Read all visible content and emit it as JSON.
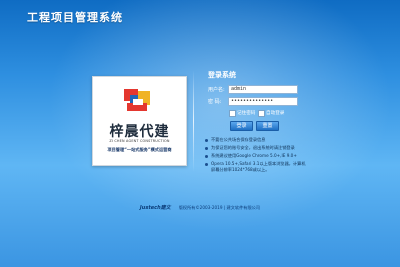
{
  "window": {
    "title": "工程项目管理系统"
  },
  "logo": {
    "cn": "梓晨代建",
    "en": "ZI CHEN AGENT CONSTRUCTION",
    "slogan": "项目管理“一站式服务”模式运营商",
    "colors": {
      "red": "#e4372f",
      "blue": "#1f66b8",
      "yellow": "#f0b326"
    }
  },
  "login": {
    "title": "登录系统",
    "username_label": "用户名:",
    "username_value": "admin",
    "password_label": "密  码:",
    "password_value": "••••••••••••••",
    "remember_label": "记住密码",
    "autologin_label": "自动登录",
    "login_button": "登录",
    "reset_button": "重置"
  },
  "notes": [
    {
      "text": "不要在公共场合保存登录信息"
    },
    {
      "text": "为保证您的账号安全，退出系统时请注销登录"
    },
    {
      "text": "系统建议使用Google Chrome 5.0+,IE 9.0+"
    },
    {
      "text": "Opera 10.5+,Safari 3.1以上版本浏览器，计算机",
      "text2": "屏幕分辨率1024*768或以上。"
    }
  ],
  "footer": {
    "logo_text": "Justech建文",
    "copyright": "版权所有©2003-2019 | 建文软件有限公司"
  },
  "colors": {
    "bg_top": "#0f6cc3",
    "bg_mid": "#5fb6f4",
    "button": "#1e6fc4"
  }
}
